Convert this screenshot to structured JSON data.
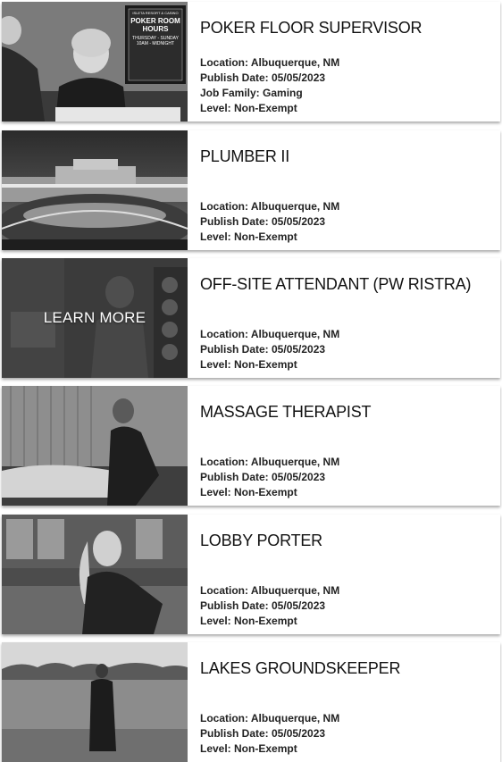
{
  "jobs": [
    {
      "title": "POKER FLOOR SUPERVISOR",
      "details": [
        "Location: Albuquerque, NM",
        "Publish Date: 05/05/2023",
        "Job Family: Gaming",
        "Level: Non-Exempt"
      ],
      "sign": [
        "ISLETA RESORT & CASINO",
        "POKER ROOM",
        "HOURS",
        "THURSDAY - SUNDAY",
        "10AM - MIDNIGHT"
      ]
    },
    {
      "title": "PLUMBER II",
      "details": [
        "Location: Albuquerque, NM",
        "Publish Date: 05/05/2023",
        "Level: Non-Exempt"
      ]
    },
    {
      "title": "OFF-SITE ATTENDANT (PW RISTRA)",
      "details": [
        "Location: Albuquerque, NM",
        "Publish Date: 05/05/2023",
        "Level: Non-Exempt"
      ],
      "overlay": "LEARN MORE"
    },
    {
      "title": "MASSAGE THERAPIST",
      "details": [
        "Location: Albuquerque, NM",
        "Publish Date: 05/05/2023",
        "Level: Non-Exempt"
      ]
    },
    {
      "title": "LOBBY PORTER",
      "details": [
        "Location: Albuquerque, NM",
        "Publish Date: 05/05/2023",
        "Level: Non-Exempt"
      ]
    },
    {
      "title": "LAKES GROUNDSKEEPER",
      "details": [
        "Location: Albuquerque, NM",
        "Publish Date: 05/05/2023",
        "Level: Non-Exempt"
      ]
    }
  ]
}
